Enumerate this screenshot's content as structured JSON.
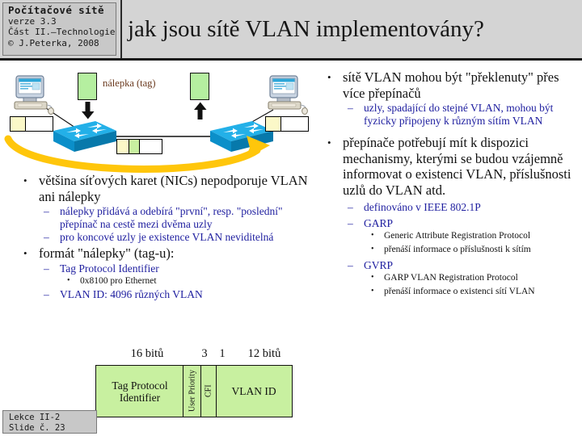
{
  "header": {
    "course": "Počítačové sítě",
    "version": "verze 3.3",
    "part": "Část II.–Technologie",
    "author": "© J.Peterka, 2008",
    "title": "jak jsou sítě VLAN implementovány?"
  },
  "footer": {
    "lecture": "Lekce II-2",
    "slide": "Slide č. 23"
  },
  "diagram": {
    "tag_label": "nálepka (tag)",
    "node_left_name": "pc-left",
    "node_right_name": "pc-right",
    "switch_left_name": "switch-left",
    "switch_right_name": "switch-right",
    "colors": {
      "tag_green": "#b5efa0",
      "frame_yellow": "#fbf8c8",
      "switch_blue": "#0b9ada",
      "flow_arrow": "#ffc60b"
    }
  },
  "left_column": [
    {
      "text": "většina síťových karet (NICs) nepodporuje VLAN ani nálepky",
      "children": [
        {
          "text": "nálepky přidává a odebírá \"první\", resp. \"poslední\" přepínač na cestě mezi dvěma uzly"
        },
        {
          "text": "pro koncové uzly je existence VLAN neviditelná"
        }
      ]
    },
    {
      "text": "formát \"nálepky\" (tag-u):",
      "children": [
        {
          "text": "Tag Protocol Identifier",
          "children": [
            {
              "text": "0x8100 pro Ethernet"
            }
          ]
        },
        {
          "text": "VLAN ID: 4096 různých VLAN"
        }
      ]
    }
  ],
  "right_column": [
    {
      "text": "sítě VLAN mohou být \"překlenuty\" přes více přepínačů",
      "children": [
        {
          "text": "uzly, spadající do stejné VLAN, mohou být fyzicky připojeny k různým sítím VLAN"
        }
      ]
    },
    {
      "text": "přepínače potřebují mít k dispozici mechanismy, kterými se budou vzájemně informovat o existenci VLAN, příslušnosti uzlů do VLAN atd.",
      "children": [
        {
          "text": "definováno v IEEE 802.1P"
        },
        {
          "text": "GARP",
          "children": [
            {
              "text": "Generic Attribute Registration Protocol"
            },
            {
              "text": "přenáší informace o příslušnosti k sítím"
            }
          ]
        },
        {
          "text": "GVRP",
          "children": [
            {
              "text": "GARP VLAN Registration Protocol"
            },
            {
              "text": "přenáší informace o existenci sítí VLAN"
            }
          ]
        }
      ]
    }
  ],
  "tag_format": {
    "bit_labels": [
      "16 bitů",
      "3",
      "1",
      "12 bitů"
    ],
    "fields": [
      {
        "label": "Tag Protocol Identifier",
        "orientation": "horizontal"
      },
      {
        "label": "User Priority",
        "orientation": "vertical"
      },
      {
        "label": "CFI",
        "orientation": "vertical"
      },
      {
        "label": "VLAN ID",
        "orientation": "horizontal"
      }
    ]
  }
}
